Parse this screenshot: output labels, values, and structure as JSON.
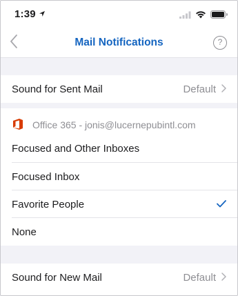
{
  "status_bar": {
    "time": "1:39",
    "icons": [
      "location-arrow-icon",
      "signal-icon",
      "wifi-icon",
      "battery-icon"
    ]
  },
  "nav": {
    "title": "Mail Notifications",
    "back_icon": "chevron-left-icon",
    "help_label": "?",
    "accent_color": "#1565c0"
  },
  "sent_mail": {
    "label": "Sound for Sent Mail",
    "value": "Default"
  },
  "account": {
    "header": "Office 365 - jonis@lucernepubintl.com",
    "icon": "office-365-icon",
    "brand_color": "#d83b01"
  },
  "inbox_options": [
    {
      "label": "Focused and Other Inboxes",
      "selected": false
    },
    {
      "label": "Focused Inbox",
      "selected": false
    },
    {
      "label": "Favorite People",
      "selected": true
    },
    {
      "label": "None",
      "selected": false
    }
  ],
  "new_mail": {
    "label": "Sound for New Mail",
    "value": "Default"
  }
}
